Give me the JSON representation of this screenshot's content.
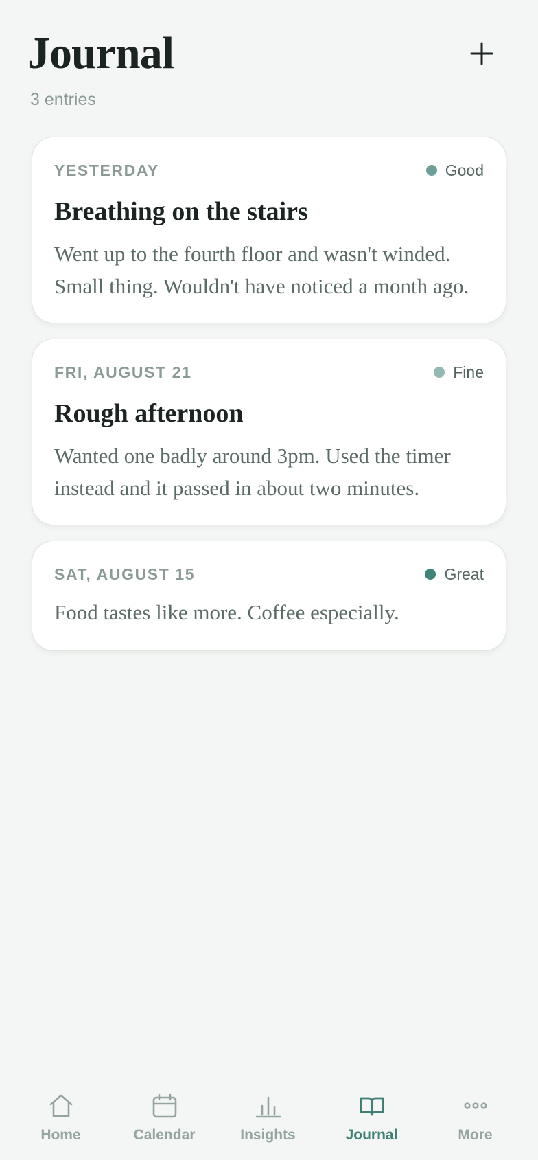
{
  "header": {
    "title": "Journal",
    "entry_count": "3 entries",
    "add_icon": "plus-icon"
  },
  "entries": [
    {
      "date": "YESTERDAY",
      "mood": "Good",
      "mood_color": "#6d9f98",
      "title": "Breathing on the stairs",
      "body": "Went up to the fourth floor and wasn't winded. Small thing. Wouldn't have noticed a month ago."
    },
    {
      "date": "FRI, AUGUST 21",
      "mood": "Fine",
      "mood_color": "#94b9b3",
      "title": "Rough afternoon",
      "body": "Wanted one badly around 3pm. Used the timer instead and it passed in about two minutes."
    },
    {
      "date": "SAT, AUGUST 15",
      "mood": "Great",
      "mood_color": "#3f8478",
      "title": "",
      "body": "Food tastes like more. Coffee especially."
    }
  ],
  "nav": {
    "active": "Journal",
    "active_color": "#3f7f74",
    "inactive_color": "#94a49e",
    "items": [
      {
        "label": "Home",
        "icon": "home-icon"
      },
      {
        "label": "Calendar",
        "icon": "calendar-icon"
      },
      {
        "label": "Insights",
        "icon": "bar-chart-icon"
      },
      {
        "label": "Journal",
        "icon": "open-book-icon"
      },
      {
        "label": "More",
        "icon": "more-dots-icon"
      }
    ]
  }
}
